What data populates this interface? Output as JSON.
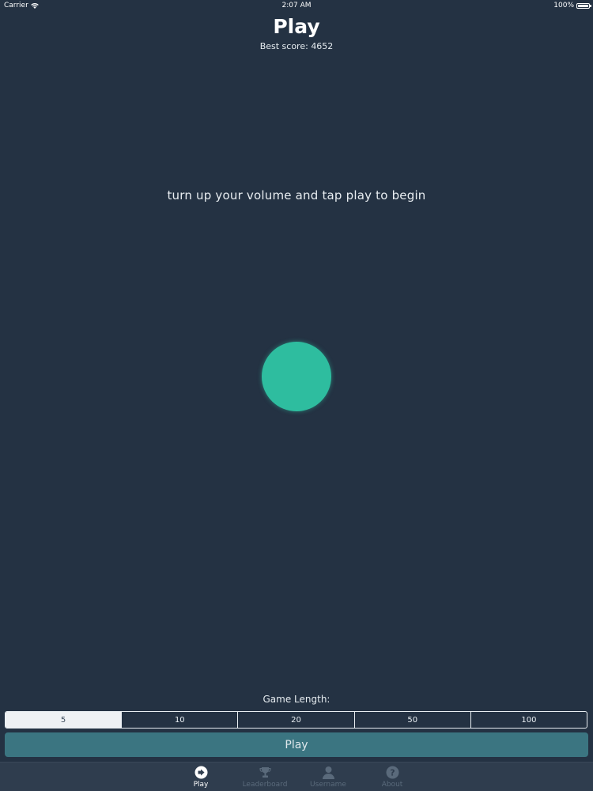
{
  "status_bar": {
    "carrier": "Carrier",
    "time": "2:07 AM",
    "battery": "100%",
    "battery_level": 1.0
  },
  "header": {
    "title": "Play",
    "best_score_label": "Best score:",
    "best_score_value": "4652"
  },
  "main": {
    "instruction": "turn up your volume and tap play to begin",
    "circle_color": "#2ebd9f"
  },
  "game_length": {
    "label": "Game Length:",
    "options": [
      "5",
      "10",
      "20",
      "50",
      "100"
    ],
    "selected": "5"
  },
  "play_button": {
    "label": "Play",
    "color": "#3b7581"
  },
  "tab_bar": {
    "tabs": [
      {
        "label": "Play",
        "icon": "play-icon",
        "active": true
      },
      {
        "label": "Leaderboard",
        "icon": "trophy-icon",
        "active": false
      },
      {
        "label": "Username",
        "icon": "user-icon",
        "active": false
      },
      {
        "label": "About",
        "icon": "question-icon",
        "active": false
      }
    ]
  },
  "colors": {
    "background": "#243243",
    "accent": "#2ebd9f",
    "tab_bar": "#2f3d4e"
  }
}
